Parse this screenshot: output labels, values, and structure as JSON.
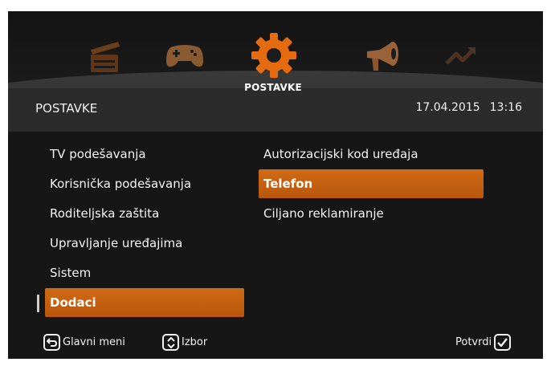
{
  "topbar": {
    "icons": [
      {
        "name": "clapperboard-icon",
        "color": "#6b3f1c"
      },
      {
        "name": "gamepad-icon",
        "color": "#8a5a32"
      },
      {
        "name": "gear-icon",
        "color": "#e56b10"
      },
      {
        "name": "megaphone-icon",
        "color": "#9a6238"
      },
      {
        "name": "trend-arrow-icon",
        "color": "#4e3322"
      }
    ],
    "active_label": "POSTAVKE"
  },
  "header": {
    "title": "POSTAVKE",
    "date": "17.04.2015",
    "time": "13:16"
  },
  "menu": {
    "left": [
      {
        "label": "TV podešavanja",
        "selected": false
      },
      {
        "label": "Korisnička podešavanja",
        "selected": false
      },
      {
        "label": "Roditeljska zaštita",
        "selected": false
      },
      {
        "label": "Upravljanje uređajima",
        "selected": false
      },
      {
        "label": "Sistem",
        "selected": false
      },
      {
        "label": "Dodaci",
        "selected": true
      }
    ],
    "right": [
      {
        "label": "Autorizacijski kod uređaja",
        "selected": false
      },
      {
        "label": "Telefon",
        "selected": true
      },
      {
        "label": "Ciljano reklamiranje",
        "selected": false
      }
    ]
  },
  "footer": {
    "back_label": "Glavni meni",
    "select_label": "Izbor",
    "confirm_label": "Potvrdi"
  },
  "colors": {
    "accent": "#c8620f",
    "background": "#161616",
    "band": "#2b2b2b"
  }
}
